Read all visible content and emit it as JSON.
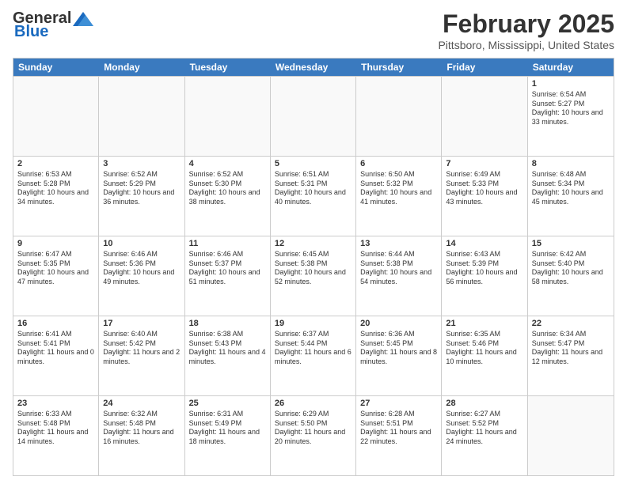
{
  "header": {
    "logo_general": "General",
    "logo_blue": "Blue",
    "title": "February 2025",
    "location": "Pittsboro, Mississippi, United States"
  },
  "days_of_week": [
    "Sunday",
    "Monday",
    "Tuesday",
    "Wednesday",
    "Thursday",
    "Friday",
    "Saturday"
  ],
  "weeks": [
    [
      {
        "day": "",
        "text": ""
      },
      {
        "day": "",
        "text": ""
      },
      {
        "day": "",
        "text": ""
      },
      {
        "day": "",
        "text": ""
      },
      {
        "day": "",
        "text": ""
      },
      {
        "day": "",
        "text": ""
      },
      {
        "day": "1",
        "text": "Sunrise: 6:54 AM\nSunset: 5:27 PM\nDaylight: 10 hours and 33 minutes."
      }
    ],
    [
      {
        "day": "2",
        "text": "Sunrise: 6:53 AM\nSunset: 5:28 PM\nDaylight: 10 hours and 34 minutes."
      },
      {
        "day": "3",
        "text": "Sunrise: 6:52 AM\nSunset: 5:29 PM\nDaylight: 10 hours and 36 minutes."
      },
      {
        "day": "4",
        "text": "Sunrise: 6:52 AM\nSunset: 5:30 PM\nDaylight: 10 hours and 38 minutes."
      },
      {
        "day": "5",
        "text": "Sunrise: 6:51 AM\nSunset: 5:31 PM\nDaylight: 10 hours and 40 minutes."
      },
      {
        "day": "6",
        "text": "Sunrise: 6:50 AM\nSunset: 5:32 PM\nDaylight: 10 hours and 41 minutes."
      },
      {
        "day": "7",
        "text": "Sunrise: 6:49 AM\nSunset: 5:33 PM\nDaylight: 10 hours and 43 minutes."
      },
      {
        "day": "8",
        "text": "Sunrise: 6:48 AM\nSunset: 5:34 PM\nDaylight: 10 hours and 45 minutes."
      }
    ],
    [
      {
        "day": "9",
        "text": "Sunrise: 6:47 AM\nSunset: 5:35 PM\nDaylight: 10 hours and 47 minutes."
      },
      {
        "day": "10",
        "text": "Sunrise: 6:46 AM\nSunset: 5:36 PM\nDaylight: 10 hours and 49 minutes."
      },
      {
        "day": "11",
        "text": "Sunrise: 6:46 AM\nSunset: 5:37 PM\nDaylight: 10 hours and 51 minutes."
      },
      {
        "day": "12",
        "text": "Sunrise: 6:45 AM\nSunset: 5:38 PM\nDaylight: 10 hours and 52 minutes."
      },
      {
        "day": "13",
        "text": "Sunrise: 6:44 AM\nSunset: 5:38 PM\nDaylight: 10 hours and 54 minutes."
      },
      {
        "day": "14",
        "text": "Sunrise: 6:43 AM\nSunset: 5:39 PM\nDaylight: 10 hours and 56 minutes."
      },
      {
        "day": "15",
        "text": "Sunrise: 6:42 AM\nSunset: 5:40 PM\nDaylight: 10 hours and 58 minutes."
      }
    ],
    [
      {
        "day": "16",
        "text": "Sunrise: 6:41 AM\nSunset: 5:41 PM\nDaylight: 11 hours and 0 minutes."
      },
      {
        "day": "17",
        "text": "Sunrise: 6:40 AM\nSunset: 5:42 PM\nDaylight: 11 hours and 2 minutes."
      },
      {
        "day": "18",
        "text": "Sunrise: 6:38 AM\nSunset: 5:43 PM\nDaylight: 11 hours and 4 minutes."
      },
      {
        "day": "19",
        "text": "Sunrise: 6:37 AM\nSunset: 5:44 PM\nDaylight: 11 hours and 6 minutes."
      },
      {
        "day": "20",
        "text": "Sunrise: 6:36 AM\nSunset: 5:45 PM\nDaylight: 11 hours and 8 minutes."
      },
      {
        "day": "21",
        "text": "Sunrise: 6:35 AM\nSunset: 5:46 PM\nDaylight: 11 hours and 10 minutes."
      },
      {
        "day": "22",
        "text": "Sunrise: 6:34 AM\nSunset: 5:47 PM\nDaylight: 11 hours and 12 minutes."
      }
    ],
    [
      {
        "day": "23",
        "text": "Sunrise: 6:33 AM\nSunset: 5:48 PM\nDaylight: 11 hours and 14 minutes."
      },
      {
        "day": "24",
        "text": "Sunrise: 6:32 AM\nSunset: 5:48 PM\nDaylight: 11 hours and 16 minutes."
      },
      {
        "day": "25",
        "text": "Sunrise: 6:31 AM\nSunset: 5:49 PM\nDaylight: 11 hours and 18 minutes."
      },
      {
        "day": "26",
        "text": "Sunrise: 6:29 AM\nSunset: 5:50 PM\nDaylight: 11 hours and 20 minutes."
      },
      {
        "day": "27",
        "text": "Sunrise: 6:28 AM\nSunset: 5:51 PM\nDaylight: 11 hours and 22 minutes."
      },
      {
        "day": "28",
        "text": "Sunrise: 6:27 AM\nSunset: 5:52 PM\nDaylight: 11 hours and 24 minutes."
      },
      {
        "day": "",
        "text": ""
      }
    ]
  ]
}
